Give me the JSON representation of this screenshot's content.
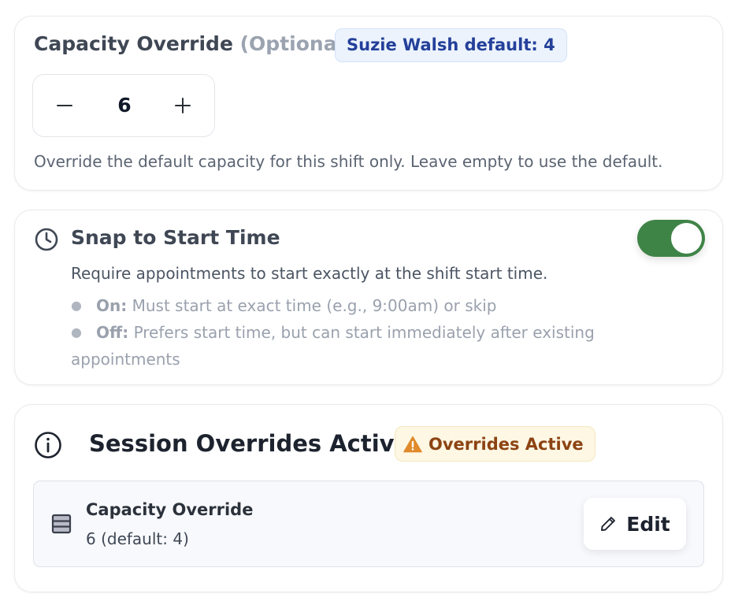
{
  "capacity": {
    "title": "Capacity Override",
    "optional": "(Optional)",
    "default_badge": "Suzie Walsh default: 4",
    "value": "6",
    "help": "Override the default capacity for this shift only. Leave empty to use the default."
  },
  "snap": {
    "title": "Snap to Start Time",
    "enabled": true,
    "description": "Require appointments to start exactly at the shift start time.",
    "on_label": "On:",
    "on_text": "Must start at exact time (e.g., 9:00am) or skip",
    "off_label": "Off:",
    "off_text_line1": "Prefers start time, but can start immediately after existing",
    "off_text_line2": "appointments"
  },
  "session": {
    "title": "Session Overrides Active:",
    "badge": "Overrides Active",
    "override_title": "Capacity Override",
    "override_value": "6 (default: 4)",
    "edit_label": "Edit"
  },
  "colors": {
    "toggle_on": "#3f8447",
    "badge_blue_bg": "#ecf3fd",
    "badge_blue_text": "#24409a",
    "warn_bg": "#fdf7e4",
    "warn_text": "#8c4312",
    "warn_icon": "#e08a2c"
  }
}
